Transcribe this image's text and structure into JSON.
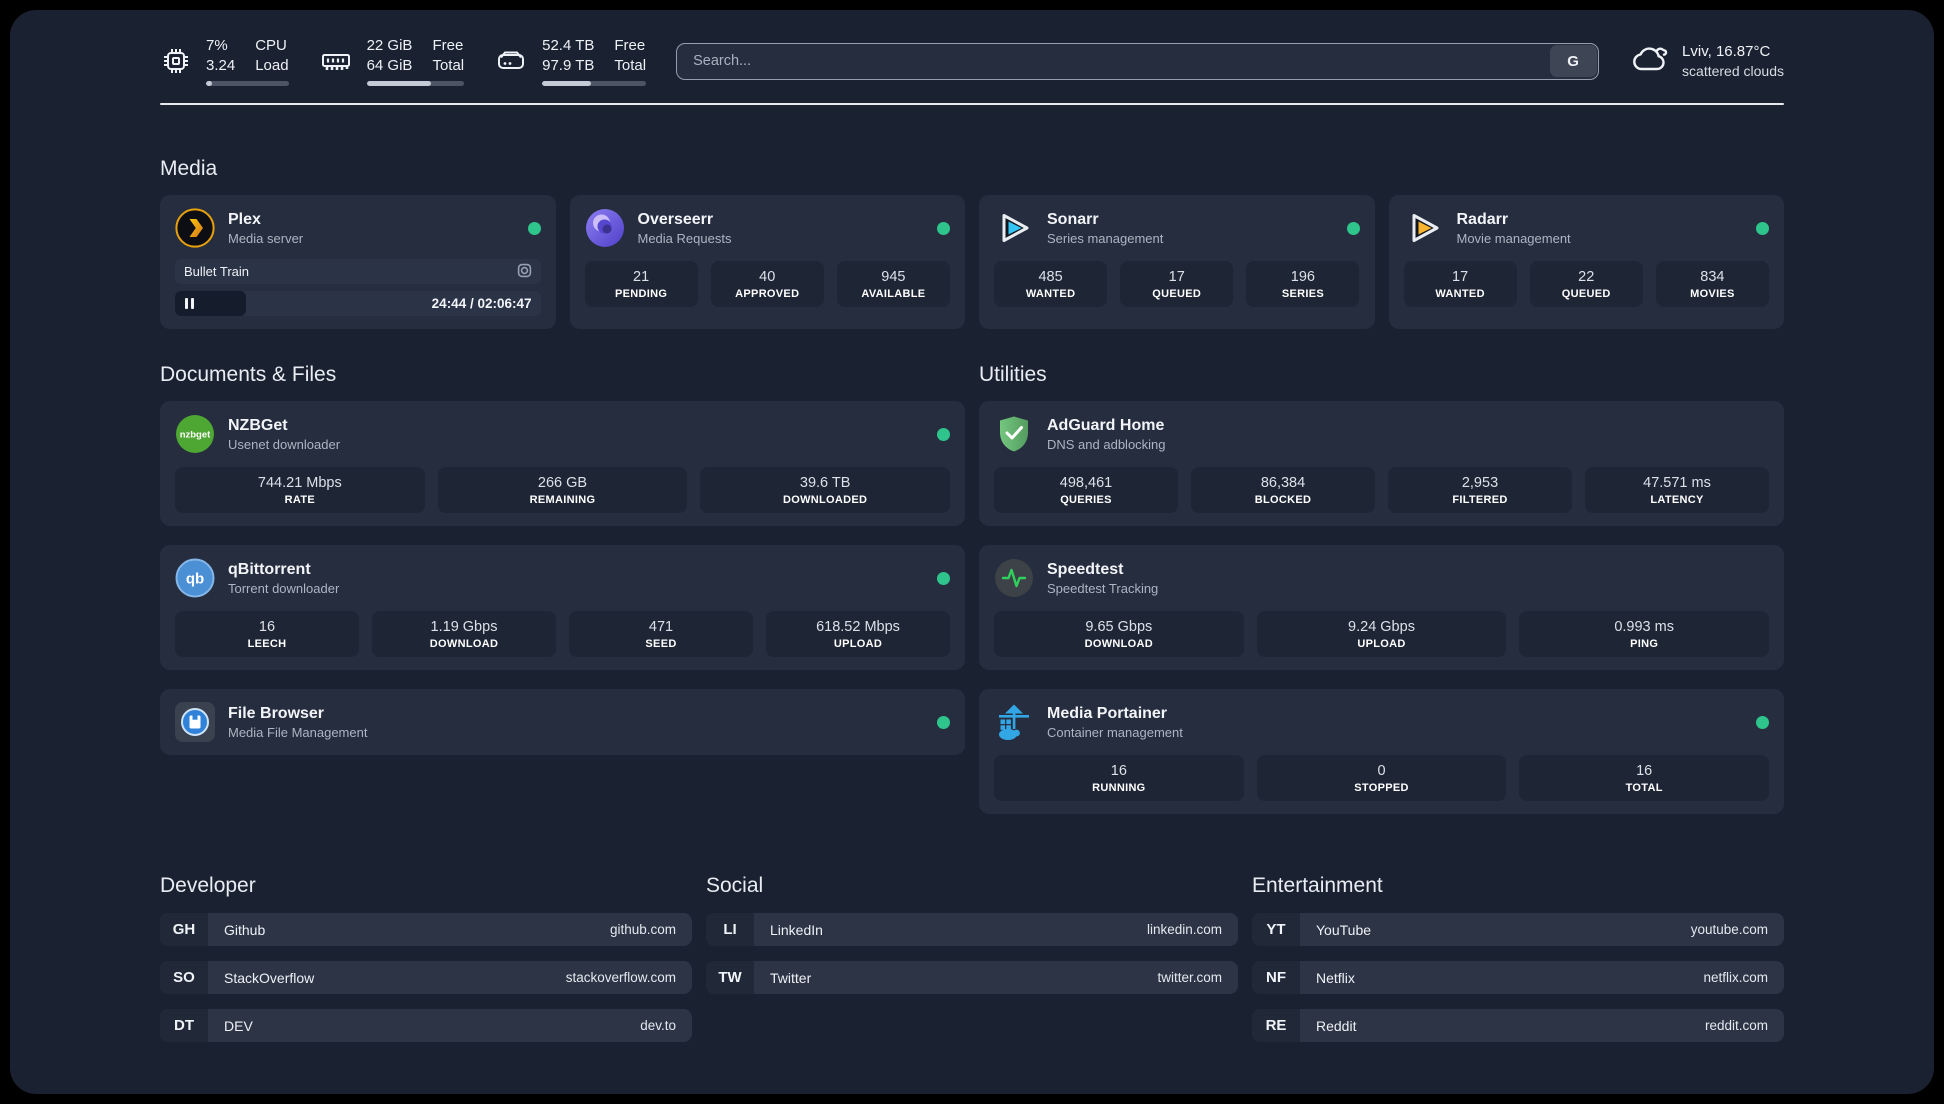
{
  "header": {
    "cpu": {
      "value1": "7%",
      "value2": "3.24",
      "label1": "CPU",
      "label2": "Load",
      "progress": 7
    },
    "ram": {
      "value1": "22 GiB",
      "value2": "64 GiB",
      "label1": "Free",
      "label2": "Total",
      "progress": 66
    },
    "disk": {
      "value1": "52.4 TB",
      "value2": "97.9 TB",
      "label1": "Free",
      "label2": "Total",
      "progress": 47
    },
    "search": {
      "placeholder": "Search...",
      "engine_button": "G"
    },
    "weather": {
      "location": "Lviv, 16.87°C",
      "condition": "scattered clouds"
    }
  },
  "section_titles": {
    "media": "Media",
    "documents": "Documents & Files",
    "utilities": "Utilities",
    "developer": "Developer",
    "social": "Social",
    "entertainment": "Entertainment"
  },
  "services": {
    "plex": {
      "name": "Plex",
      "desc": "Media server",
      "now_playing": "Bullet Train",
      "time": "24:44 / 02:06:47",
      "progress": 19.5
    },
    "overseerr": {
      "name": "Overseerr",
      "desc": "Media Requests",
      "stats": [
        {
          "value": "21",
          "label": "PENDING"
        },
        {
          "value": "40",
          "label": "APPROVED"
        },
        {
          "value": "945",
          "label": "AVAILABLE"
        }
      ]
    },
    "sonarr": {
      "name": "Sonarr",
      "desc": "Series management",
      "stats": [
        {
          "value": "485",
          "label": "WANTED"
        },
        {
          "value": "17",
          "label": "QUEUED"
        },
        {
          "value": "196",
          "label": "SERIES"
        }
      ]
    },
    "radarr": {
      "name": "Radarr",
      "desc": "Movie management",
      "stats": [
        {
          "value": "17",
          "label": "WANTED"
        },
        {
          "value": "22",
          "label": "QUEUED"
        },
        {
          "value": "834",
          "label": "MOVIES"
        }
      ]
    },
    "nzbget": {
      "name": "NZBGet",
      "desc": "Usenet downloader",
      "stats": [
        {
          "value": "744.21 Mbps",
          "label": "RATE"
        },
        {
          "value": "266 GB",
          "label": "REMAINING"
        },
        {
          "value": "39.6 TB",
          "label": "DOWNLOADED"
        }
      ]
    },
    "qbittorrent": {
      "name": "qBittorrent",
      "desc": "Torrent downloader",
      "stats": [
        {
          "value": "16",
          "label": "LEECH"
        },
        {
          "value": "1.19 Gbps",
          "label": "DOWNLOAD"
        },
        {
          "value": "471",
          "label": "SEED"
        },
        {
          "value": "618.52 Mbps",
          "label": "UPLOAD"
        }
      ]
    },
    "filebrowser": {
      "name": "File Browser",
      "desc": "Media File Management"
    },
    "adguard": {
      "name": "AdGuard Home",
      "desc": "DNS and adblocking",
      "stats": [
        {
          "value": "498,461",
          "label": "QUERIES"
        },
        {
          "value": "86,384",
          "label": "BLOCKED"
        },
        {
          "value": "2,953",
          "label": "FILTERED"
        },
        {
          "value": "47.571 ms",
          "label": "LATENCY"
        }
      ]
    },
    "speedtest": {
      "name": "Speedtest",
      "desc": "Speedtest Tracking",
      "stats": [
        {
          "value": "9.65 Gbps",
          "label": "DOWNLOAD"
        },
        {
          "value": "9.24 Gbps",
          "label": "UPLOAD"
        },
        {
          "value": "0.993 ms",
          "label": "PING"
        }
      ]
    },
    "portainer": {
      "name": "Media Portainer",
      "desc": "Container management",
      "stats": [
        {
          "value": "16",
          "label": "RUNNING"
        },
        {
          "value": "0",
          "label": "STOPPED"
        },
        {
          "value": "16",
          "label": "TOTAL"
        }
      ]
    }
  },
  "links": {
    "developer": [
      {
        "tag": "GH",
        "name": "Github",
        "url": "github.com"
      },
      {
        "tag": "SO",
        "name": "StackOverflow",
        "url": "stackoverflow.com"
      },
      {
        "tag": "DT",
        "name": "DEV",
        "url": "dev.to"
      }
    ],
    "social": [
      {
        "tag": "LI",
        "name": "LinkedIn",
        "url": "linkedin.com"
      },
      {
        "tag": "TW",
        "name": "Twitter",
        "url": "twitter.com"
      }
    ],
    "entertainment": [
      {
        "tag": "YT",
        "name": "YouTube",
        "url": "youtube.com"
      },
      {
        "tag": "NF",
        "name": "Netflix",
        "url": "netflix.com"
      },
      {
        "tag": "RE",
        "name": "Reddit",
        "url": "reddit.com"
      }
    ]
  },
  "colors": {
    "status_online": "#2ec48b",
    "plex_orange": "#e8a00c",
    "sonarr_cyan": "#35c5f4",
    "radarr_yellow": "#f9b42d",
    "adguard_green": "#67b279",
    "portainer_blue": "#33a7e6"
  }
}
